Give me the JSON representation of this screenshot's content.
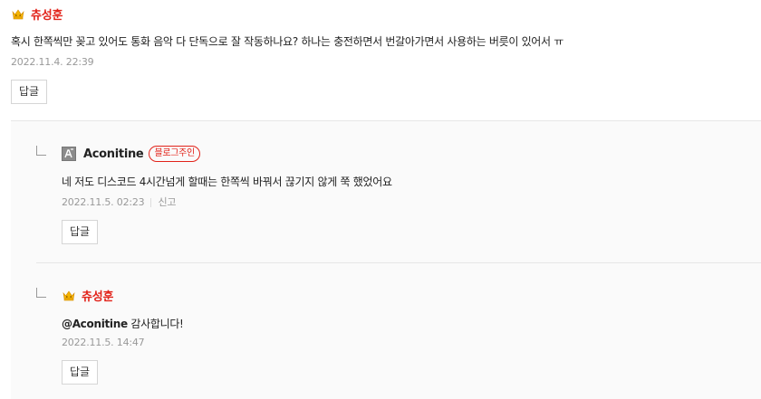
{
  "comments": [
    {
      "author": "츄성훈",
      "icon": "emoji-king-icon",
      "text": "혹시 한쪽씩만 꽂고 있어도 통화 음악 다 단독으로 잘 작동하나요? 하나는 충전하면서 번갈아가면서 사용하는 버릇이 있어서 ㅠ",
      "timestamp": "2022.11.4. 22:39",
      "reply_label": "답글"
    }
  ],
  "replies": [
    {
      "author": "Aconitine",
      "icon": "profile-logo-icon",
      "badge": "블로그주인",
      "text": "네 저도 디스코드 4시간넘게 할때는 한쪽씩 바꿔서 끊기지 않게 쭉 했었어요",
      "timestamp": "2022.11.5. 02:23",
      "report_label": "신고",
      "reply_label": "답글"
    },
    {
      "author": "츄성훈",
      "icon": "emoji-king-icon",
      "mention": "@Aconitine",
      "text": " 감사합니다!",
      "timestamp": "2022.11.5. 14:47",
      "reply_label": "답글"
    }
  ],
  "colors": {
    "author_red": "#e2231a",
    "meta_gray": "#999999",
    "reply_background": "#fafafa"
  }
}
